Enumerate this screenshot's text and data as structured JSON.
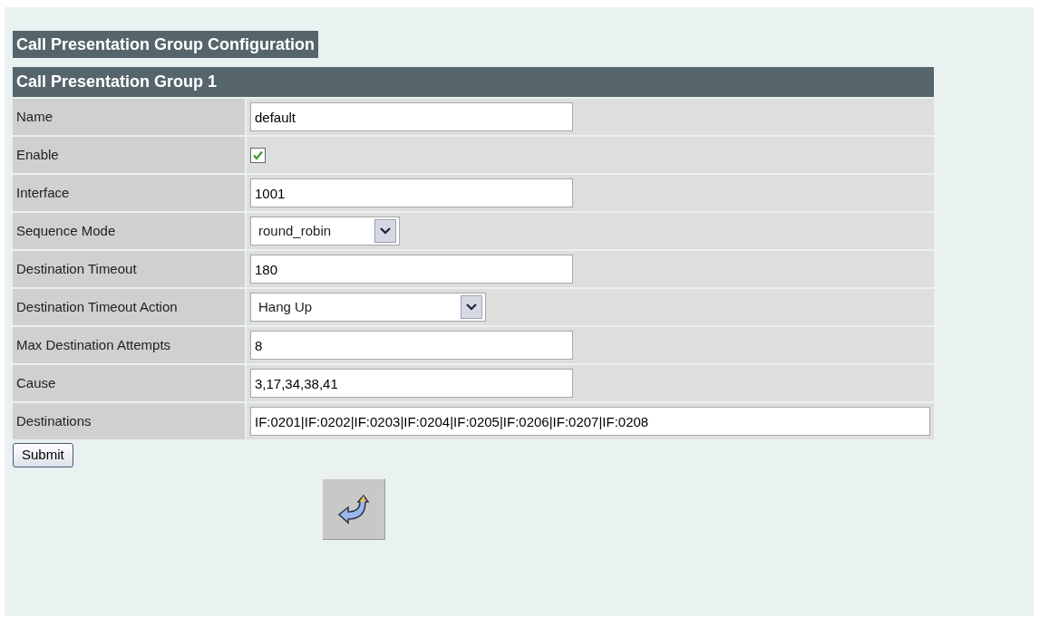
{
  "page_title": "Call Presentation Group Configuration",
  "group": {
    "title": "Call Presentation Group 1",
    "fields": [
      {
        "label": "Name",
        "kind": "text",
        "value": "default"
      },
      {
        "label": "Enable",
        "kind": "checkbox",
        "checked": true
      },
      {
        "label": "Interface",
        "kind": "text",
        "value": "1001"
      },
      {
        "label": "Sequence Mode",
        "kind": "select",
        "value": "round_robin"
      },
      {
        "label": "Destination Timeout",
        "kind": "text",
        "value": "180"
      },
      {
        "label": "Destination Timeout Action",
        "kind": "select",
        "value": "Hang Up"
      },
      {
        "label": "Max Destination Attempts",
        "kind": "text",
        "value": "8"
      },
      {
        "label": "Cause",
        "kind": "text",
        "value": "3,17,34,38,41"
      },
      {
        "label": "Destinations",
        "kind": "wide-text",
        "value": "IF:0201|IF:0202|IF:0203|IF:0204|IF:0205|IF:0206|IF:0207|IF:0208"
      }
    ]
  },
  "submit_button": "Submit"
}
